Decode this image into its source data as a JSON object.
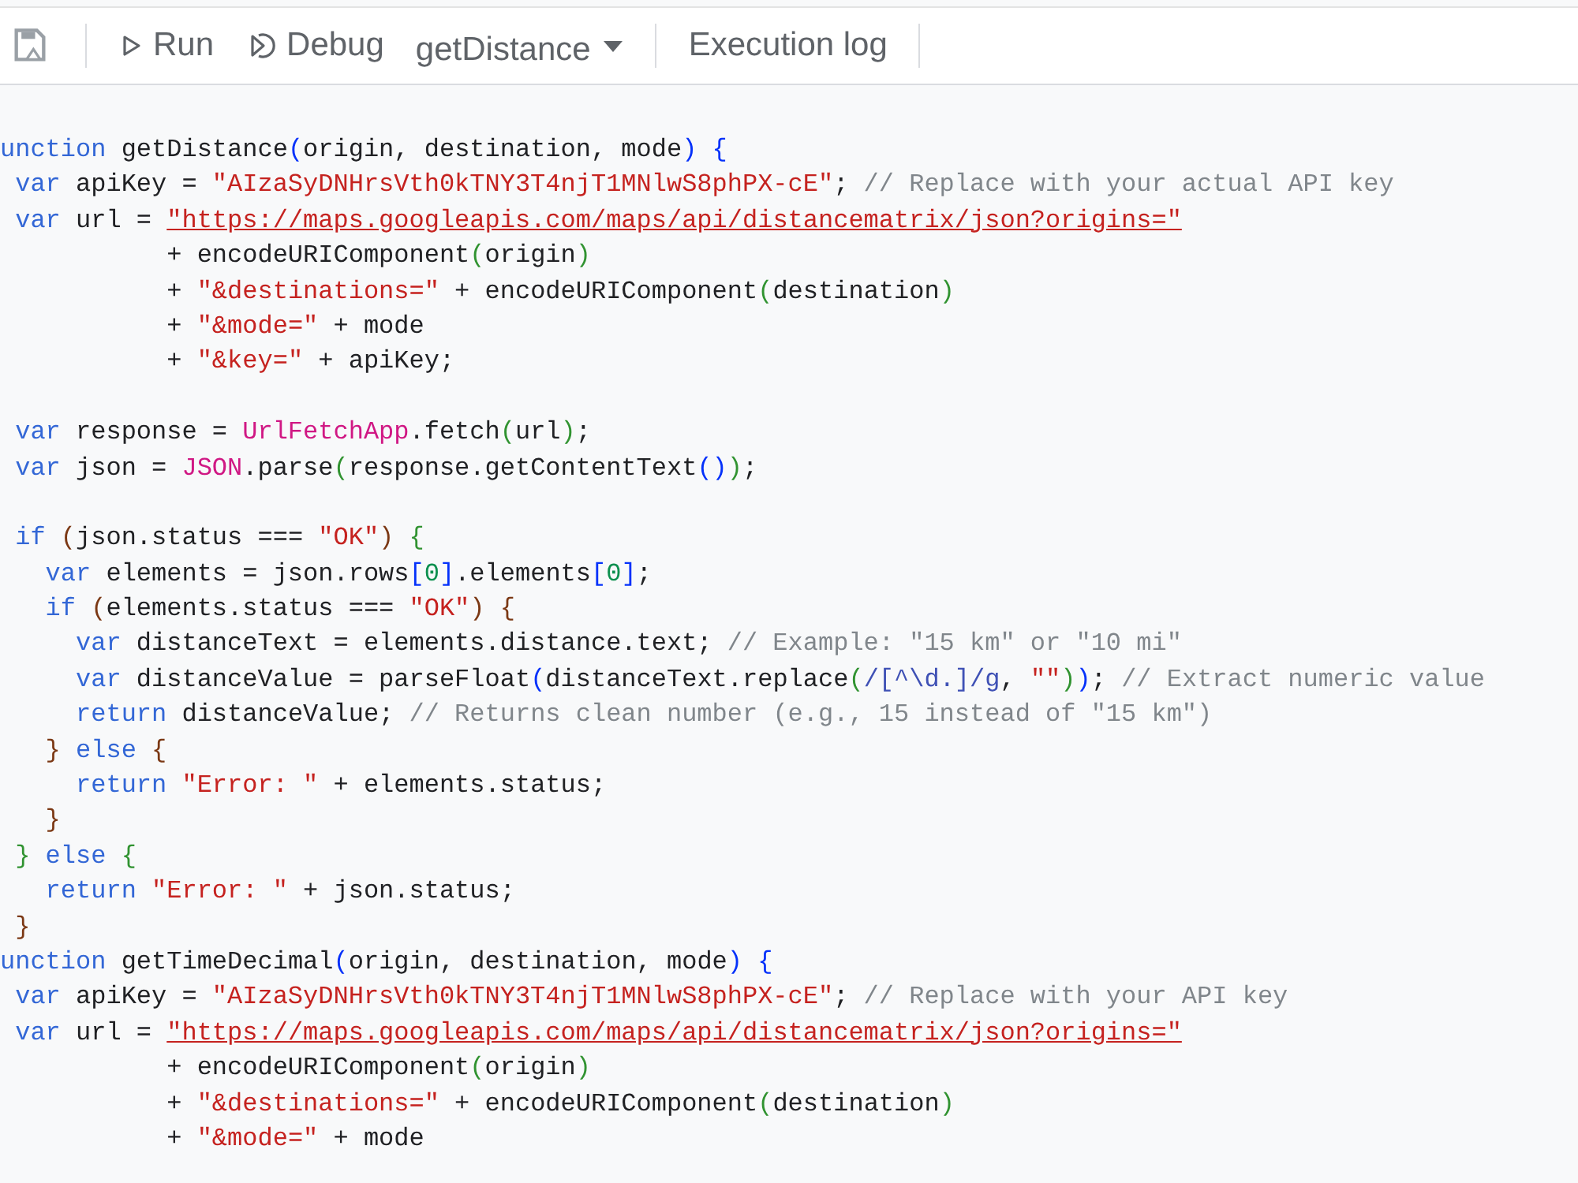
{
  "toolbar": {
    "run_label": "Run",
    "debug_label": "Debug",
    "function_select": "getDistance",
    "execution_log": "Execution log"
  },
  "editor": {
    "lines": [
      {
        "kind": "code",
        "tokens": [
          {
            "kind": "kw",
            "text": "unction"
          },
          {
            "kind": "plain",
            "text": " getDistance"
          },
          {
            "kind": "b1",
            "text": "("
          },
          {
            "kind": "plain",
            "text": "origin, destination, mode"
          },
          {
            "kind": "b1",
            "text": ")"
          },
          {
            "kind": "b1",
            "text": " {"
          }
        ]
      },
      {
        "kind": "code",
        "tokens": [
          {
            "kind": "kw",
            "text": " var"
          },
          {
            "kind": "plain",
            "text": " apiKey = "
          },
          {
            "kind": "str",
            "text": "\"AIzaSyDNHrsVth0kTNY3T4njT1MNlwS8phPX-cE\""
          },
          {
            "kind": "plain",
            "text": "; "
          },
          {
            "kind": "com",
            "text": "// Replace with your actual API key"
          }
        ]
      },
      {
        "kind": "code",
        "tokens": [
          {
            "kind": "kw",
            "text": " var"
          },
          {
            "kind": "plain",
            "text": " url = "
          },
          {
            "kind": "url",
            "text": "\"https://maps.googleapis.com/maps/api/distancematrix/json?origins=\""
          }
        ]
      },
      {
        "kind": "code",
        "tokens": [
          {
            "kind": "plain",
            "text": "           + encodeURIComponent"
          },
          {
            "kind": "b2",
            "text": "("
          },
          {
            "kind": "plain",
            "text": "origin"
          },
          {
            "kind": "b2",
            "text": ")"
          }
        ]
      },
      {
        "kind": "code",
        "tokens": [
          {
            "kind": "plain",
            "text": "           + "
          },
          {
            "kind": "str",
            "text": "\"&destinations=\""
          },
          {
            "kind": "plain",
            "text": " + encodeURIComponent"
          },
          {
            "kind": "b2",
            "text": "("
          },
          {
            "kind": "plain",
            "text": "destination"
          },
          {
            "kind": "b2",
            "text": ")"
          }
        ]
      },
      {
        "kind": "code",
        "tokens": [
          {
            "kind": "plain",
            "text": "           + "
          },
          {
            "kind": "str",
            "text": "\"&mode=\""
          },
          {
            "kind": "plain",
            "text": " + mode"
          }
        ]
      },
      {
        "kind": "code",
        "tokens": [
          {
            "kind": "plain",
            "text": "           + "
          },
          {
            "kind": "str",
            "text": "\"&key=\""
          },
          {
            "kind": "plain",
            "text": " + apiKey;"
          }
        ]
      },
      {
        "kind": "blank"
      },
      {
        "kind": "code",
        "tokens": [
          {
            "kind": "kw",
            "text": " var"
          },
          {
            "kind": "plain",
            "text": " response = "
          },
          {
            "kind": "global",
            "text": "UrlFetchApp"
          },
          {
            "kind": "plain",
            "text": ".fetch"
          },
          {
            "kind": "b2",
            "text": "("
          },
          {
            "kind": "plain",
            "text": "url"
          },
          {
            "kind": "b2",
            "text": ")"
          },
          {
            "kind": "plain",
            "text": ";"
          }
        ]
      },
      {
        "kind": "code",
        "tokens": [
          {
            "kind": "kw",
            "text": " var"
          },
          {
            "kind": "plain",
            "text": " json = "
          },
          {
            "kind": "global",
            "text": "JSON"
          },
          {
            "kind": "plain",
            "text": ".parse"
          },
          {
            "kind": "b2",
            "text": "("
          },
          {
            "kind": "plain",
            "text": "response.getContentText"
          },
          {
            "kind": "b1",
            "text": "()"
          },
          {
            "kind": "b2",
            "text": ")"
          },
          {
            "kind": "plain",
            "text": ";"
          }
        ]
      },
      {
        "kind": "blank"
      },
      {
        "kind": "code",
        "tokens": [
          {
            "kind": "kw",
            "text": " if"
          },
          {
            "kind": "b3",
            "text": " ("
          },
          {
            "kind": "plain",
            "text": "json.status === "
          },
          {
            "kind": "str",
            "text": "\"OK\""
          },
          {
            "kind": "b3",
            "text": ")"
          },
          {
            "kind": "b2",
            "text": " {"
          }
        ]
      },
      {
        "kind": "code",
        "tokens": [
          {
            "kind": "kw",
            "text": "   var"
          },
          {
            "kind": "plain",
            "text": " elements = json.rows"
          },
          {
            "kind": "b1",
            "text": "["
          },
          {
            "kind": "num",
            "text": "0"
          },
          {
            "kind": "b1",
            "text": "]"
          },
          {
            "kind": "plain",
            "text": ".elements"
          },
          {
            "kind": "b1",
            "text": "["
          },
          {
            "kind": "num",
            "text": "0"
          },
          {
            "kind": "b1",
            "text": "]"
          },
          {
            "kind": "plain",
            "text": ";"
          }
        ]
      },
      {
        "kind": "code",
        "tokens": [
          {
            "kind": "kw",
            "text": "   if"
          },
          {
            "kind": "b3",
            "text": " ("
          },
          {
            "kind": "plain",
            "text": "elements.status === "
          },
          {
            "kind": "str",
            "text": "\"OK\""
          },
          {
            "kind": "b3",
            "text": ")"
          },
          {
            "kind": "b3",
            "text": " {"
          }
        ]
      },
      {
        "kind": "code",
        "tokens": [
          {
            "kind": "kw",
            "text": "     var"
          },
          {
            "kind": "plain",
            "text": " distanceText = elements.distance.text; "
          },
          {
            "kind": "com",
            "text": "// Example: \"15 km\" or \"10 mi\""
          }
        ]
      },
      {
        "kind": "code",
        "tokens": [
          {
            "kind": "kw",
            "text": "     var"
          },
          {
            "kind": "plain",
            "text": " distanceValue = parseFloat"
          },
          {
            "kind": "b1",
            "text": "("
          },
          {
            "kind": "plain",
            "text": "distanceText.replace"
          },
          {
            "kind": "b2",
            "text": "("
          },
          {
            "kind": "regex",
            "text": "/[^\\d.]/g"
          },
          {
            "kind": "plain",
            "text": ", "
          },
          {
            "kind": "str",
            "text": "\"\""
          },
          {
            "kind": "b2",
            "text": ")"
          },
          {
            "kind": "b1",
            "text": ")"
          },
          {
            "kind": "plain",
            "text": "; "
          },
          {
            "kind": "com",
            "text": "// Extract numeric value"
          }
        ]
      },
      {
        "kind": "code",
        "tokens": [
          {
            "kind": "kw",
            "text": "     return"
          },
          {
            "kind": "plain",
            "text": " distanceValue; "
          },
          {
            "kind": "com",
            "text": "// Returns clean number (e.g., 15 instead of \"15 km\")"
          }
        ]
      },
      {
        "kind": "code",
        "tokens": [
          {
            "kind": "b3",
            "text": "   }"
          },
          {
            "kind": "kw",
            "text": " else"
          },
          {
            "kind": "b3",
            "text": " {"
          }
        ]
      },
      {
        "kind": "code",
        "tokens": [
          {
            "kind": "kw",
            "text": "     return"
          },
          {
            "kind": "str",
            "text": " \"Error: \""
          },
          {
            "kind": "plain",
            "text": " + elements.status;"
          }
        ]
      },
      {
        "kind": "code",
        "tokens": [
          {
            "kind": "b3",
            "text": "   }"
          }
        ]
      },
      {
        "kind": "code",
        "tokens": [
          {
            "kind": "b2",
            "text": " }"
          },
          {
            "kind": "kw",
            "text": " else"
          },
          {
            "kind": "b2",
            "text": " {"
          }
        ]
      },
      {
        "kind": "code",
        "tokens": [
          {
            "kind": "kw",
            "text": "   return"
          },
          {
            "kind": "str",
            "text": " \"Error: \""
          },
          {
            "kind": "plain",
            "text": " + json.status;"
          }
        ]
      },
      {
        "kind": "code",
        "tokens": [
          {
            "kind": "b3",
            "text": " }"
          }
        ]
      },
      {
        "kind": "code",
        "tokens": [
          {
            "kind": "kw",
            "text": "unction"
          },
          {
            "kind": "plain",
            "text": " getTimeDecimal"
          },
          {
            "kind": "b1",
            "text": "("
          },
          {
            "kind": "plain",
            "text": "origin, destination, mode"
          },
          {
            "kind": "b1",
            "text": ")"
          },
          {
            "kind": "b1",
            "text": " {"
          }
        ]
      },
      {
        "kind": "code",
        "tokens": [
          {
            "kind": "kw",
            "text": " var"
          },
          {
            "kind": "plain",
            "text": " apiKey = "
          },
          {
            "kind": "str",
            "text": "\"AIzaSyDNHrsVth0kTNY3T4njT1MNlwS8phPX-cE\""
          },
          {
            "kind": "plain",
            "text": "; "
          },
          {
            "kind": "com",
            "text": "// Replace with your API key"
          }
        ]
      },
      {
        "kind": "code",
        "tokens": [
          {
            "kind": "kw",
            "text": " var"
          },
          {
            "kind": "plain",
            "text": " url = "
          },
          {
            "kind": "url",
            "text": "\"https://maps.googleapis.com/maps/api/distancematrix/json?origins=\""
          }
        ]
      },
      {
        "kind": "code",
        "tokens": [
          {
            "kind": "plain",
            "text": "           + encodeURIComponent"
          },
          {
            "kind": "b2",
            "text": "("
          },
          {
            "kind": "plain",
            "text": "origin"
          },
          {
            "kind": "b2",
            "text": ")"
          }
        ]
      },
      {
        "kind": "code",
        "tokens": [
          {
            "kind": "plain",
            "text": "           + "
          },
          {
            "kind": "str",
            "text": "\"&destinations=\""
          },
          {
            "kind": "plain",
            "text": " + encodeURIComponent"
          },
          {
            "kind": "b2",
            "text": "("
          },
          {
            "kind": "plain",
            "text": "destination"
          },
          {
            "kind": "b2",
            "text": ")"
          }
        ]
      },
      {
        "kind": "code",
        "tokens": [
          {
            "kind": "plain",
            "text": "           + "
          },
          {
            "kind": "str",
            "text": "\"&mode=\""
          },
          {
            "kind": "plain",
            "text": " + mode"
          }
        ]
      }
    ]
  }
}
